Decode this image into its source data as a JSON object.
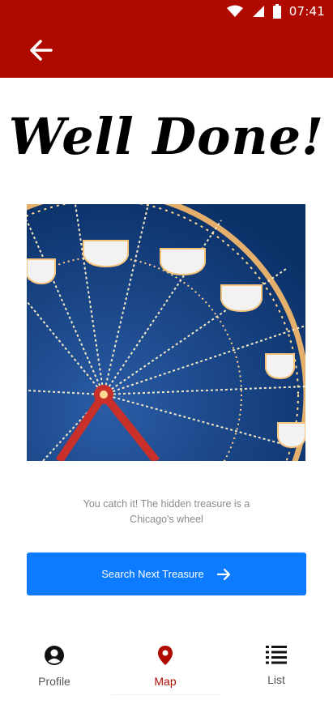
{
  "status_bar": {
    "time": "07:41",
    "icons": [
      "wifi-icon",
      "signal-icon",
      "battery-icon"
    ]
  },
  "app_bar": {
    "back_icon": "arrow-left-icon",
    "color": "#ae0a00"
  },
  "result": {
    "title": "Well Done!",
    "image_description": "ferris-wheel-photo",
    "message": "You catch it! The hidden treasure is a Chicago's wheel"
  },
  "cta": {
    "label": "Search Next Treasure",
    "icon": "arrow-right-icon",
    "color": "#0c7bff"
  },
  "bottom_nav": {
    "items": [
      {
        "label": "Profile",
        "icon": "user-circle-icon",
        "active": false
      },
      {
        "label": "Map",
        "icon": "map-pin-icon",
        "active": true
      },
      {
        "label": "List",
        "icon": "list-icon",
        "active": false
      }
    ],
    "active_color": "#ae0a00"
  }
}
